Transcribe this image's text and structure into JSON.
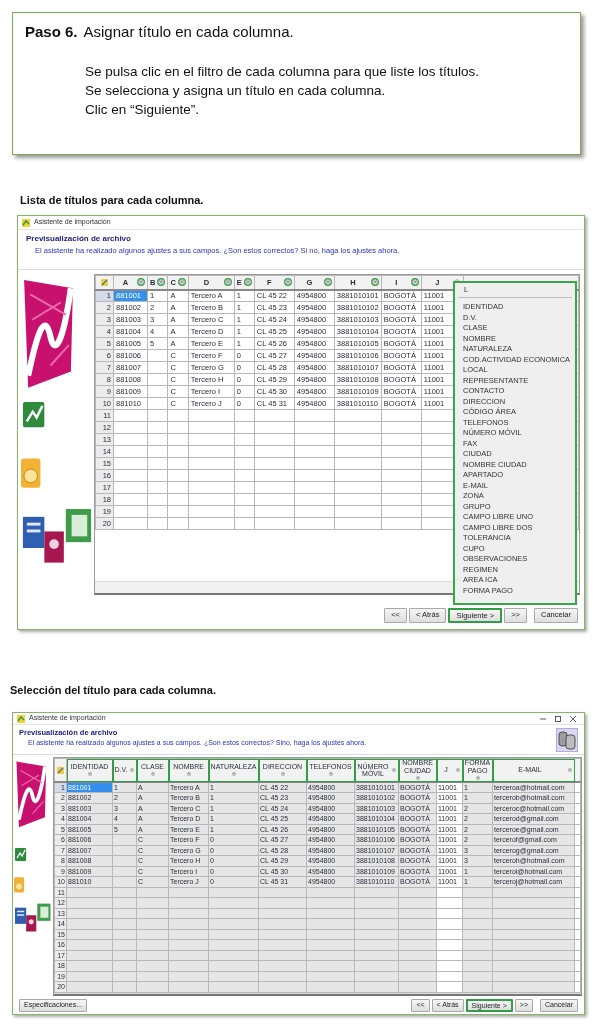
{
  "instructions": {
    "step": "Paso 6.",
    "title": "Asignar título en cada columna.",
    "lines": [
      "Se pulsa clic en el filtro de cada columna para que liste los títulos.",
      "Se selecciona y asigna un título en cada columna.",
      "Clic en “Siguiente”."
    ]
  },
  "sections": [
    {
      "heading": "Lista de títulos para cada columna.",
      "window": {
        "kind": "preview",
        "title": "Asistente de importación",
        "header": "Previsualización de archivo",
        "subtitle": "El asistente ha realizado algunos ajustes a sus campos. ¿Son estos correctos? Si no, haga los ajustes ahora.",
        "columns": [
          {
            "label": "A",
            "highlighted": true,
            "shaded": false
          },
          {
            "label": "B",
            "highlighted": true,
            "shaded": false
          },
          {
            "label": "C",
            "highlighted": true,
            "shaded": false
          },
          {
            "label": "D",
            "highlighted": true,
            "shaded": false
          },
          {
            "label": "E",
            "highlighted": true,
            "shaded": false
          },
          {
            "label": "F",
            "highlighted": true,
            "shaded": false
          },
          {
            "label": "G",
            "highlighted": true,
            "shaded": false
          },
          {
            "label": "H",
            "highlighted": true,
            "shaded": false
          },
          {
            "label": "I",
            "highlighted": true,
            "shaded": false
          },
          {
            "label": "J",
            "highlighted": false,
            "shaded": false
          }
        ],
        "rows": [
          {
            "number": "1",
            "selected": true,
            "cells": [
              "881001",
              "1",
              "A",
              "Tercero A",
              "1",
              "CL 45 22",
              "4954800",
              "3881010101",
              "BOGOTÁ",
              "11001"
            ]
          },
          {
            "number": "2",
            "selected": false,
            "cells": [
              "881002",
              "2",
              "A",
              "Tercero B",
              "1",
              "CL 45 23",
              "4954800",
              "3881010102",
              "BOGOTÁ",
              "11001"
            ]
          },
          {
            "number": "3",
            "selected": false,
            "cells": [
              "881003",
              "3",
              "A",
              "Tercero C",
              "1",
              "CL 45 24",
              "4954800",
              "3881010103",
              "BOGOTÁ",
              "11001"
            ]
          },
          {
            "number": "4",
            "selected": false,
            "cells": [
              "881004",
              "4",
              "A",
              "Tercero D",
              "1",
              "CL 45 25",
              "4954800",
              "3881010104",
              "BOGOTÁ",
              "11001"
            ]
          },
          {
            "number": "5",
            "selected": false,
            "cells": [
              "881005",
              "5",
              "A",
              "Tercero E",
              "1",
              "CL 45 26",
              "4954800",
              "3881010105",
              "BOGOTÁ",
              "11001"
            ]
          },
          {
            "number": "6",
            "selected": false,
            "cells": [
              "881006",
              null,
              "C",
              "Tercero F",
              "0",
              "CL 45 27",
              "4954800",
              "3881010106",
              "BOGOTÁ",
              "11001"
            ]
          },
          {
            "number": "7",
            "selected": false,
            "cells": [
              "881007",
              null,
              "C",
              "Tercero G",
              "0",
              "CL 45 28",
              "4954800",
              "3881010107",
              "BOGOTÁ",
              "11001"
            ]
          },
          {
            "number": "8",
            "selected": false,
            "cells": [
              "881008",
              null,
              "C",
              "Tercero H",
              "0",
              "CL 45 29",
              "4954800",
              "3881010108",
              "BOGOTÁ",
              "11001"
            ]
          },
          {
            "number": "9",
            "selected": false,
            "cells": [
              "881009",
              null,
              "C",
              "Tercero I",
              "0",
              "CL 45 30",
              "4954800",
              "3881010109",
              "BOGOTÁ",
              "11001"
            ]
          },
          {
            "number": "10",
            "selected": false,
            "cells": [
              "881010",
              null,
              "C",
              "Tercero J",
              "0",
              "CL 45 31",
              "4954800",
              "3881010110",
              "BOGOTÁ",
              "11001"
            ]
          },
          {
            "number": "11",
            "selected": false
          },
          {
            "number": "12",
            "selected": false
          },
          {
            "number": "13",
            "selected": false
          },
          {
            "number": "14",
            "selected": false
          },
          {
            "number": "15",
            "selected": false
          },
          {
            "number": "16",
            "selected": false
          },
          {
            "number": "17",
            "selected": false
          },
          {
            "number": "18",
            "selected": false
          },
          {
            "number": "19",
            "selected": false
          },
          {
            "number": "20",
            "selected": false
          }
        ],
        "dropdown": {
          "filter": "L",
          "items": [
            "IDENTIDAD",
            "D.V.",
            "CLASE",
            "NOMBRE",
            "NATURALEZA",
            "COD.ACTIVIDAD ECONOMICA",
            "LOCAL",
            "REPRESENTANTE",
            "CONTACTO",
            "DIRECCION",
            "CÓDIGO ÁREA",
            "TELEFONOS",
            "NÚMERO MÓVIL",
            "FAX",
            "CIUDAD",
            "NOMBRE CIUDAD",
            "APARTADO",
            "E-MAIL",
            "ZONA",
            "GRUPO",
            "CAMPO LIBRE UNO",
            "CAMPO LIBRE DOS",
            "TOLERANCIA",
            "CUPO",
            "OBSERVACIONES",
            "REGIMEN",
            "AREA ICA",
            "FORMA PAGO"
          ]
        },
        "buttons": [
          {
            "kind": "first",
            "label": "<<",
            "highlighted": false
          },
          {
            "kind": "back",
            "label": "< Atrás",
            "highlighted": false
          },
          {
            "kind": "next",
            "label": "Siguiente >",
            "highlighted": true
          },
          {
            "kind": "last",
            "label": ">>",
            "highlighted": false
          },
          {
            "kind": "cancel",
            "label": "Cancelar",
            "highlighted": false
          }
        ]
      }
    },
    {
      "heading": "Selección del título para cada columna.",
      "window": {
        "kind": "assigned",
        "title": "Asistente de importación",
        "header": "Previsualización de archivo",
        "subtitle": "El asistente ha realizado algunos ajustes a sus campos. ¿Son estos correctos? Sino, haga los ajustes ahora.",
        "columns": [
          {
            "label": "IDENTIDAD",
            "highlighted": true,
            "shaded": true
          },
          {
            "label": "D.V.",
            "highlighted": true,
            "shaded": true
          },
          {
            "label": "CLASE",
            "highlighted": true,
            "shaded": true
          },
          {
            "label": "NOMBRE",
            "highlighted": true,
            "shaded": true
          },
          {
            "label": "NATURALEZA",
            "highlighted": true,
            "shaded": true
          },
          {
            "label": "DIRECCION",
            "highlighted": true,
            "shaded": true
          },
          {
            "label": "TELEFONOS",
            "highlighted": true,
            "shaded": true
          },
          {
            "label": "NÚMERO MÓVIL",
            "highlighted": true,
            "shaded": true
          },
          {
            "label": "NOMBRE CIUDAD",
            "highlighted": true,
            "shaded": true
          },
          {
            "label": "J",
            "highlighted": true,
            "shaded": false
          },
          {
            "label": "FORMA PAGO",
            "highlighted": true,
            "shaded": true
          },
          {
            "label": "E-MAIL",
            "highlighted": true,
            "shaded": true
          }
        ],
        "rows": [
          {
            "number": "1",
            "selected": true,
            "cells": [
              "881001",
              "1",
              "A",
              "Tercero A",
              "1",
              "CL 45 22",
              "4954800",
              "3881010101",
              "BOGOTÁ",
              "11001",
              "1",
              "terceroa@hotmail.com"
            ]
          },
          {
            "number": "2",
            "selected": false,
            "cells": [
              "881002",
              "2",
              "A",
              "Tercero B",
              "1",
              "CL 45 23",
              "4954800",
              "3881010102",
              "BOGOTÁ",
              "11001",
              "1",
              "tercerob@hotmail.com"
            ]
          },
          {
            "number": "3",
            "selected": false,
            "cells": [
              "881003",
              "3",
              "A",
              "Tercero C",
              "1",
              "CL 45 24",
              "4954800",
              "3881010103",
              "BOGOTÁ",
              "11001",
              "2",
              "terceroc@hotmail.com"
            ]
          },
          {
            "number": "4",
            "selected": false,
            "cells": [
              "881004",
              "4",
              "A",
              "Tercero D",
              "1",
              "CL 45 25",
              "4954800",
              "3881010104",
              "BOGOTÁ",
              "11001",
              "2",
              "tercerod@gmail.com"
            ]
          },
          {
            "number": "5",
            "selected": false,
            "cells": [
              "881005",
              "5",
              "A",
              "Tercero E",
              "1",
              "CL 45 26",
              "4954800",
              "3881010105",
              "BOGOTÁ",
              "11001",
              "2",
              "terceroe@gmail.com"
            ]
          },
          {
            "number": "6",
            "selected": false,
            "cells": [
              "881006",
              null,
              "C",
              "Tercero F",
              "0",
              "CL 45 27",
              "4954800",
              "3881010106",
              "BOGOTÁ",
              "11001",
              "2",
              "tercerof@gmail.com"
            ]
          },
          {
            "number": "7",
            "selected": false,
            "cells": [
              "881007",
              null,
              "C",
              "Tercero G",
              "0",
              "CL 45 28",
              "4954800",
              "3881010107",
              "BOGOTÁ",
              "11001",
              "3",
              "tercerog@gmail.com"
            ]
          },
          {
            "number": "8",
            "selected": false,
            "cells": [
              "881008",
              null,
              "C",
              "Tercero H",
              "0",
              "CL 45 29",
              "4954800",
              "3881010108",
              "BOGOTÁ",
              "11001",
              "3",
              "terceroh@hotmail.com"
            ]
          },
          {
            "number": "9",
            "selected": false,
            "cells": [
              "881009",
              null,
              "C",
              "Tercero I",
              "0",
              "CL 45 30",
              "4954800",
              "3881010109",
              "BOGOTÁ",
              "11001",
              "1",
              "terceroi@hotmail.com"
            ]
          },
          {
            "number": "10",
            "selected": false,
            "cells": [
              "881010",
              null,
              "C",
              "Tercero J",
              "0",
              "CL 45 31",
              "4954800",
              "3881010110",
              "BOGOTÁ",
              "11001",
              "1",
              "terceroj@hotmail.com"
            ]
          },
          {
            "number": "11",
            "selected": false
          },
          {
            "number": "12",
            "selected": false
          },
          {
            "number": "13",
            "selected": false
          },
          {
            "number": "14",
            "selected": false
          },
          {
            "number": "15",
            "selected": false
          },
          {
            "number": "16",
            "selected": false
          },
          {
            "number": "17",
            "selected": false
          },
          {
            "number": "18",
            "selected": false
          },
          {
            "number": "19",
            "selected": false
          },
          {
            "number": "20",
            "selected": false
          }
        ],
        "buttons": [
          {
            "kind": "specs",
            "label": "Especificaciones...",
            "highlighted": false
          },
          {
            "kind": "first",
            "label": "<<",
            "highlighted": false
          },
          {
            "kind": "back",
            "label": "< Atrás",
            "highlighted": false
          },
          {
            "kind": "next",
            "label": "Siguiente >",
            "highlighted": true
          },
          {
            "kind": "last",
            "label": ">>",
            "highlighted": false
          },
          {
            "kind": "cancel",
            "label": "Cancelar",
            "highlighted": false
          }
        ]
      }
    }
  ]
}
